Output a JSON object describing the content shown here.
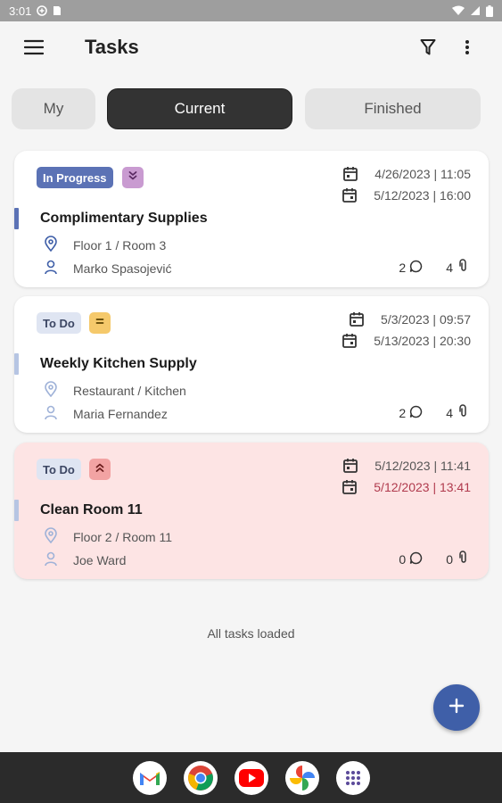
{
  "status_bar": {
    "time": "3:01"
  },
  "app_bar": {
    "title": "Tasks"
  },
  "tabs": [
    {
      "label": "My",
      "active": false
    },
    {
      "label": "Current",
      "active": true
    },
    {
      "label": "Finished",
      "active": false
    }
  ],
  "tasks": [
    {
      "status": "In Progress",
      "priority_icon": "chevrons-down-icon",
      "start": "4/26/2023 | 11:05",
      "due": "5/12/2023 | 16:00",
      "title": "Complimentary Supplies",
      "location": "Floor 1 / Room 3",
      "assignee": "Marko  Spasojević",
      "comments": "2",
      "attachments": "4",
      "colors": {
        "accent": "#5b72b5",
        "priority_bg": "#c99bd1"
      }
    },
    {
      "status": "To Do",
      "priority_icon": "equals-icon",
      "start": "5/3/2023 | 09:57",
      "due": "5/13/2023 | 20:30",
      "title": "Weekly Kitchen Supply",
      "location": "Restaurant / Kitchen",
      "assignee": "Maria Fernandez",
      "comments": "2",
      "attachments": "4",
      "colors": {
        "accent": "#b6c5e3",
        "priority_bg": "#f5c96b"
      }
    },
    {
      "status": "To Do",
      "priority_icon": "chevrons-up-icon",
      "start": "5/12/2023 | 11:41",
      "due": "5/12/2023 | 13:41",
      "title": "Clean Room 11",
      "location": "Floor 2 / Room 11",
      "assignee": "Joe  Ward",
      "comments": "0",
      "attachments": "0",
      "overdue": true,
      "colors": {
        "accent": "#b6c5e3",
        "priority_bg": "#f2a3a3"
      }
    }
  ],
  "footer": {
    "all_loaded": "All tasks loaded"
  },
  "fab": {
    "icon": "plus-icon"
  },
  "dock": [
    "gmail-icon",
    "chrome-icon",
    "youtube-icon",
    "photos-icon",
    "apps-icon"
  ],
  "colors": {
    "primary": "#3f5fa8",
    "active_tab": "#333333",
    "overdue_text": "#b03a4d",
    "card_pink": "#fde4e4"
  }
}
